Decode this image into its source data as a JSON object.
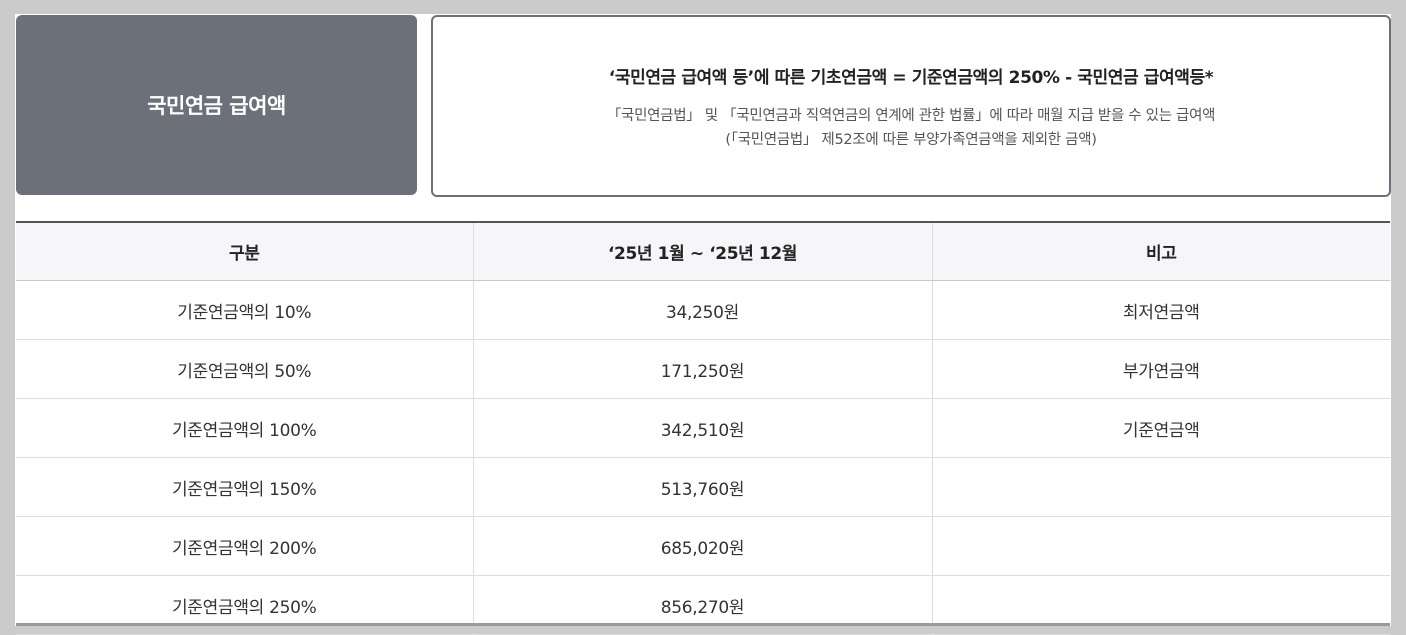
{
  "label_box": {
    "title": "국민연금 급여액"
  },
  "formula": {
    "title": "‘국민연금 급여액 등’에 따른 기초연금액 = 기준연금액의 250% - 국민연금 급여액등*",
    "desc_line1": "「국민연금법」 및 「국민연금과 직역연금의 연계에 관한 법률」에 따라 매월 지급 받을 수 있는 급여액",
    "desc_line2": "(「국민연금법」 제52조에 따른 부양가족연금액을 제외한 금액)"
  },
  "table": {
    "headers": [
      "구분",
      "‘25년 1월 ~ ‘25년 12월",
      "비고"
    ],
    "rows": [
      [
        "기준연금액의 10%",
        "34,250원",
        "최저연금액"
      ],
      [
        "기준연금액의 50%",
        "171,250원",
        "부가연금액"
      ],
      [
        "기준연금액의 100%",
        "342,510원",
        "기준연금액"
      ],
      [
        "기준연금액의 150%",
        "513,760원",
        ""
      ],
      [
        "기준연금액의 200%",
        "685,020원",
        ""
      ],
      [
        "기준연금액의 250%",
        "856,270원",
        ""
      ]
    ]
  }
}
